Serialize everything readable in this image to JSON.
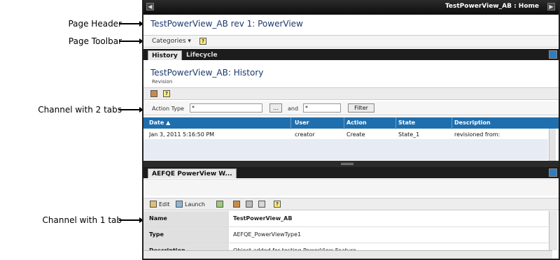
{
  "callouts": {
    "page_header": "Page Header",
    "page_toolbar": "Page Toolbar",
    "channel_two_tabs": "Channel with 2 tabs",
    "channel_one_tab": "Channel with 1 tab"
  },
  "window": {
    "title": "TestPowerView_AB : Home"
  },
  "page": {
    "header": "TestPowerView_AB rev 1: PowerView",
    "toolbar": {
      "categories_label": "Categories ▾"
    }
  },
  "channel1": {
    "tabs": [
      {
        "label": "History"
      },
      {
        "label": "Lifecycle"
      }
    ],
    "title": "TestPowerView_AB: History",
    "subtitle": "Revision",
    "filter": {
      "action_type_label": "Action Type",
      "action_type_value": "*",
      "browse_label": "...",
      "and_label": "and",
      "and_value": "*",
      "filter_button": "Filter"
    },
    "columns": {
      "date": "Date ▲",
      "user": "User",
      "action": "Action",
      "state": "State",
      "description": "Description"
    },
    "row": {
      "date": "Jan 3, 2011 5:16:50 PM",
      "user": "creator",
      "action": "Create",
      "state": "State_1",
      "description": "revisioned from:"
    }
  },
  "channel2": {
    "tabs": [
      {
        "label": "AEFQE PowerView W..."
      }
    ],
    "actions": {
      "edit": "Edit",
      "launch": "Launch"
    },
    "properties": [
      {
        "key": "Name",
        "value": "TestPowerView_AB"
      },
      {
        "key": "Type",
        "value": "AEFQE_PowerViewType1"
      },
      {
        "key": "Description",
        "value": "Object added for testing PowerView Feature"
      }
    ]
  },
  "colors": {
    "accent": "#1f6fae",
    "header_text": "#1a3a6e",
    "dark_bar": "#1c1c1c"
  }
}
